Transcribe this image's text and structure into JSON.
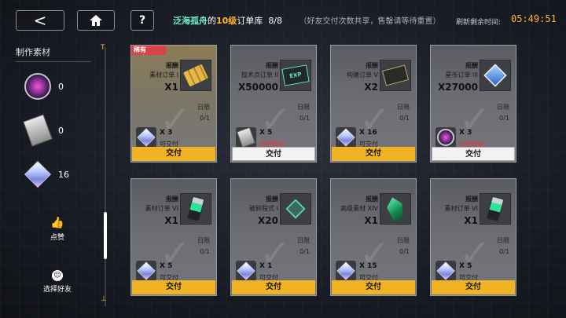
{
  "header": {
    "back_icon": "<",
    "home_icon": "home-icon",
    "help_icon": "?",
    "title_a": "泛海孤舟",
    "title_b": "的",
    "title_c": "10级",
    "title_d": "订单库",
    "progress": "8/8",
    "note": "（好友交付次数共享，售罄请等待重置）",
    "refresh_label": "刷新剩余时间:",
    "timer": "05:49:51"
  },
  "sidebar": {
    "title": "制作素材",
    "rail_top": "T",
    "rail_bottom": "⊥",
    "materials": [
      {
        "icon": "purple-orb-icon",
        "count": "0"
      },
      {
        "icon": "chip-card-icon",
        "count": "0"
      },
      {
        "icon": "crystal-cube-icon",
        "count": "16"
      }
    ],
    "like_label": "点赞",
    "choose_friend_label": "选择好友"
  },
  "cards": [
    {
      "rare": true,
      "badge": "稀有",
      "reward": "报酬",
      "name": "素材订单 I",
      "qty": "X1",
      "limit_label": "日限",
      "limit": "0/1",
      "req_qty": "X 3",
      "status": "可交付",
      "status_bad": false,
      "deliver": "交付",
      "deliver_white": false,
      "item_icon": "gold-bars-icon",
      "req_icon": "crystal-cube-icon"
    },
    {
      "rare": false,
      "badge": "",
      "reward": "报酬",
      "name": "技术点订单 II",
      "qty": "X50000",
      "limit_label": "日限",
      "limit": "0/1",
      "req_qty": "X 5",
      "status": "资源暂缺",
      "status_bad": true,
      "deliver": "交付",
      "deliver_white": true,
      "item_icon": "exp-card-icon",
      "req_icon": "chip-card-icon"
    },
    {
      "rare": false,
      "badge": "",
      "reward": "报酬",
      "name": "构建订单 V",
      "qty": "X2",
      "limit_label": "日限",
      "limit": "0/1",
      "req_qty": "X 16",
      "status": "可交付",
      "status_bad": false,
      "deliver": "交付",
      "deliver_white": false,
      "item_icon": "ticket-icon",
      "req_icon": "crystal-cube-icon"
    },
    {
      "rare": false,
      "badge": "",
      "reward": "报酬",
      "name": "星币订单 III",
      "qty": "X27000",
      "limit_label": "日限",
      "limit": "0/1",
      "req_qty": "X 3",
      "status": "资源暂缺",
      "status_bad": true,
      "deliver": "交付",
      "deliver_white": true,
      "item_icon": "blue-seal-icon",
      "req_icon": "purple-orb-icon"
    },
    {
      "rare": false,
      "badge": "",
      "reward": "报酬",
      "name": "素材订单 VI",
      "qty": "X1",
      "limit_label": "日限",
      "limit": "0/1",
      "req_qty": "X 5",
      "status": "可交付",
      "status_bad": false,
      "deliver": "交付",
      "deliver_white": false,
      "item_icon": "green-fragment-icon",
      "req_icon": "crystal-cube-icon"
    },
    {
      "rare": false,
      "badge": "",
      "reward": "报酬",
      "name": "破碎程式 I",
      "qty": "X20",
      "limit_label": "日限",
      "limit": "0/1",
      "req_qty": "X 1",
      "status": "可交付",
      "status_bad": false,
      "deliver": "交付",
      "deliver_white": false,
      "item_icon": "green-diamond-icon",
      "req_icon": "crystal-cube-icon"
    },
    {
      "rare": false,
      "badge": "",
      "reward": "报酬",
      "name": "高级素材 XIV",
      "qty": "X1",
      "limit_label": "日限",
      "limit": "0/1",
      "req_qty": "X 15",
      "status": "可交付",
      "status_bad": false,
      "deliver": "交付",
      "deliver_white": false,
      "item_icon": "green-crystal-icon",
      "req_icon": "crystal-cube-icon"
    },
    {
      "rare": false,
      "badge": "",
      "reward": "报酬",
      "name": "素材订单 VI",
      "qty": "X1",
      "limit_label": "日限",
      "limit": "0/1",
      "req_qty": "X 5",
      "status": "可交付",
      "status_bad": false,
      "deliver": "交付",
      "deliver_white": false,
      "item_icon": "green-fragment-icon",
      "req_icon": "crystal-cube-icon"
    }
  ]
}
